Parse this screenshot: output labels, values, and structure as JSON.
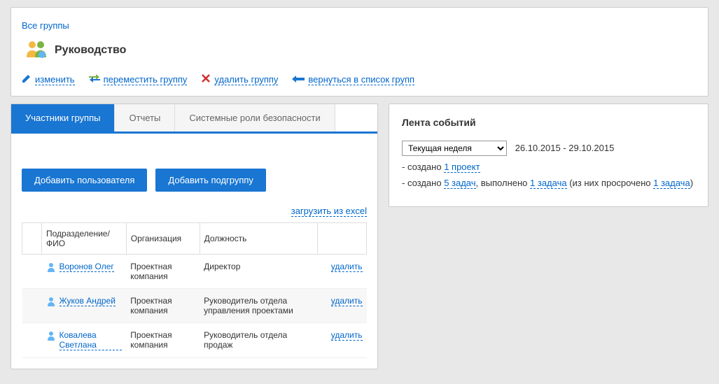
{
  "breadcrumb": "Все группы",
  "group": {
    "title": "Руководство"
  },
  "actions": {
    "edit": "изменить",
    "move": "переместить группу",
    "delete": "удалить группу",
    "back": "вернуться в список групп"
  },
  "tabs": [
    "Участники группы",
    "Отчеты",
    "Системные роли безопасности"
  ],
  "buttons": {
    "add_user": "Добавить пользователя",
    "add_subgroup": "Добавить подгруппу"
  },
  "excel_link": "загрузить из excel",
  "table": {
    "headers": {
      "name": "Подразделение/ФИО",
      "org": "Организация",
      "role": "Должность"
    },
    "rows": [
      {
        "name": "Воронов Олег",
        "org": "Проектная компания",
        "role": "Директор",
        "del": "удалить"
      },
      {
        "name": "Жуков Андрей",
        "org": "Проектная компания",
        "role": "Руководитель отдела управления проектами",
        "del": "удалить"
      },
      {
        "name": "Ковалева Светлана",
        "org": "Проектная компания",
        "role": "Руководитель отдела продаж",
        "del": "удалить"
      }
    ]
  },
  "feed": {
    "title": "Лента событий",
    "period_select": "Текущая неделя",
    "date_range": "26.10.2015 - 29.10.2015",
    "line1_prefix": "- создано ",
    "line1_link": "1 проект",
    "line2_prefix": "- создано ",
    "line2_link1": "5 задач",
    "line2_mid": ", выполнено ",
    "line2_link2": "1 задача",
    "line2_mid2": " (из них просрочено ",
    "line2_link3": "1 задача",
    "line2_end": ")"
  }
}
